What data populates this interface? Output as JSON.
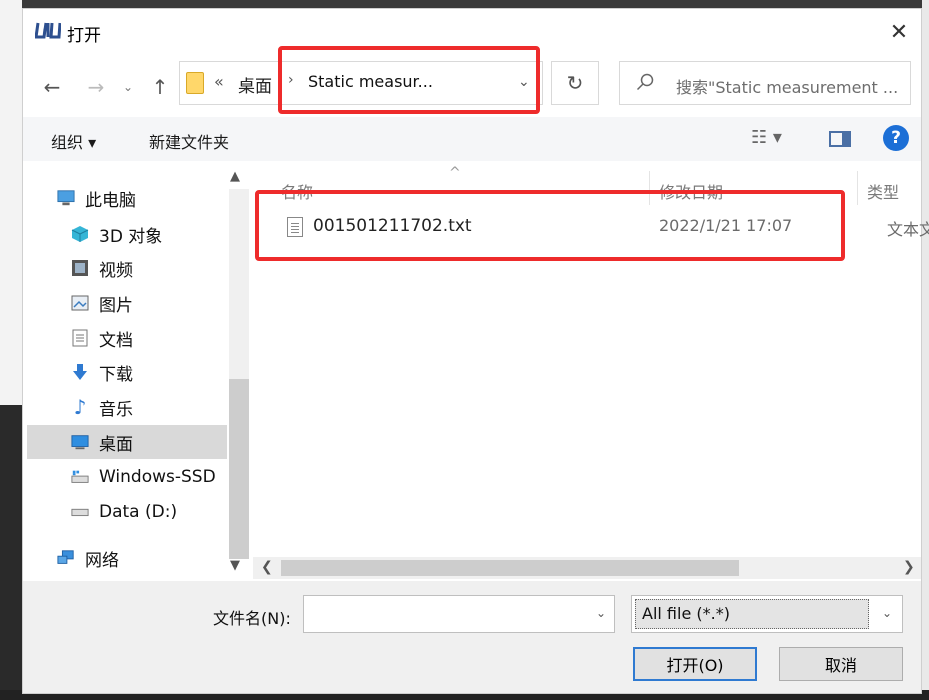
{
  "window": {
    "title": "打开"
  },
  "nav": {
    "back": "←",
    "forward": "→",
    "recent": "⌄",
    "up": "↑"
  },
  "address": {
    "overflow": "«",
    "crumbs": [
      "桌面",
      "Static measur..."
    ],
    "separator": "›"
  },
  "search": {
    "placeholder": "搜索\"Static measurement ..."
  },
  "toolbar": {
    "organize_label": "组织 ▾",
    "new_folder_label": "新建文件夹",
    "view_label": "☷ ▾",
    "help_label": "?"
  },
  "sidebar": {
    "items": [
      {
        "label": "此电脑",
        "icon": "computer-icon"
      },
      {
        "label": "3D 对象",
        "icon": "cube-icon"
      },
      {
        "label": "视频",
        "icon": "video-icon"
      },
      {
        "label": "图片",
        "icon": "picture-icon"
      },
      {
        "label": "文档",
        "icon": "document-icon"
      },
      {
        "label": "下载",
        "icon": "download-icon"
      },
      {
        "label": "音乐",
        "icon": "music-icon"
      },
      {
        "label": "桌面",
        "icon": "desktop-icon",
        "selected": true
      },
      {
        "label": "Windows-SSD",
        "icon": "drive-icon"
      },
      {
        "label": "Data (D:)",
        "icon": "drive-icon"
      },
      {
        "label": "网络",
        "icon": "network-icon"
      }
    ]
  },
  "columns": {
    "name": "名称",
    "modified": "修改日期",
    "type": "类型"
  },
  "files": [
    {
      "name": "001501211702.txt",
      "modified": "2022/1/21 17:07",
      "type": "文本文档"
    }
  ],
  "footer": {
    "filename_label": "文件名(N):",
    "filename_value": "",
    "filetype_value": "All file (*.*)",
    "open_label": "打开(O)",
    "cancel_label": "取消"
  },
  "colors": {
    "highlight": "#ee2b2b",
    "accent": "#1c6fd6"
  }
}
